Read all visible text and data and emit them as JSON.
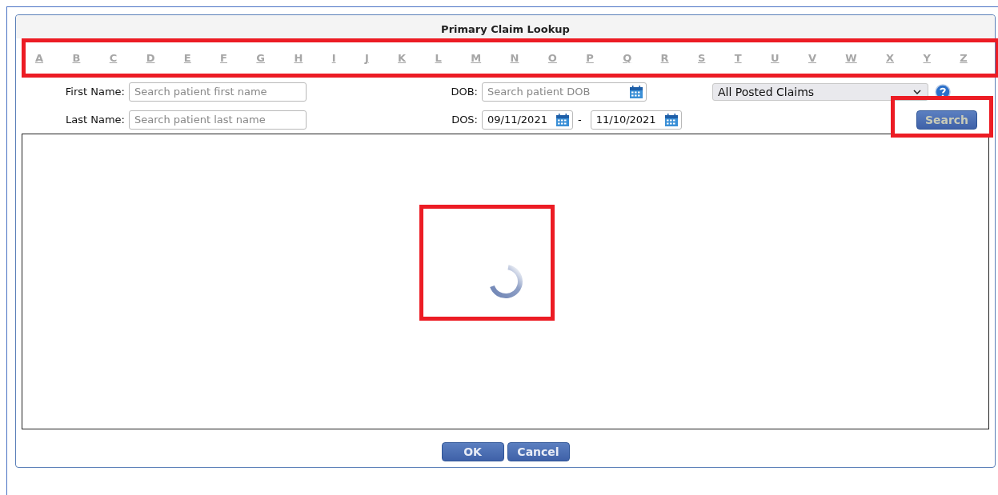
{
  "dialog": {
    "title": "Primary Claim Lookup"
  },
  "letters": [
    "A",
    "B",
    "C",
    "D",
    "E",
    "F",
    "G",
    "H",
    "I",
    "J",
    "K",
    "L",
    "M",
    "N",
    "O",
    "P",
    "Q",
    "R",
    "S",
    "T",
    "U",
    "V",
    "W",
    "X",
    "Y",
    "Z"
  ],
  "first_name": {
    "label": "First Name:",
    "placeholder": "Search patient first name"
  },
  "last_name": {
    "label": "Last Name:",
    "placeholder": "Search patient last name"
  },
  "dob": {
    "label": "DOB:",
    "placeholder": "Search patient DOB"
  },
  "dos": {
    "label": "DOS:",
    "from": "09/11/2021",
    "separator": "-",
    "to": "11/10/2021"
  },
  "claim_filter": {
    "value": "All Posted Claims"
  },
  "search_button": "Search",
  "buttons": [
    "OK",
    "Cancel"
  ]
}
